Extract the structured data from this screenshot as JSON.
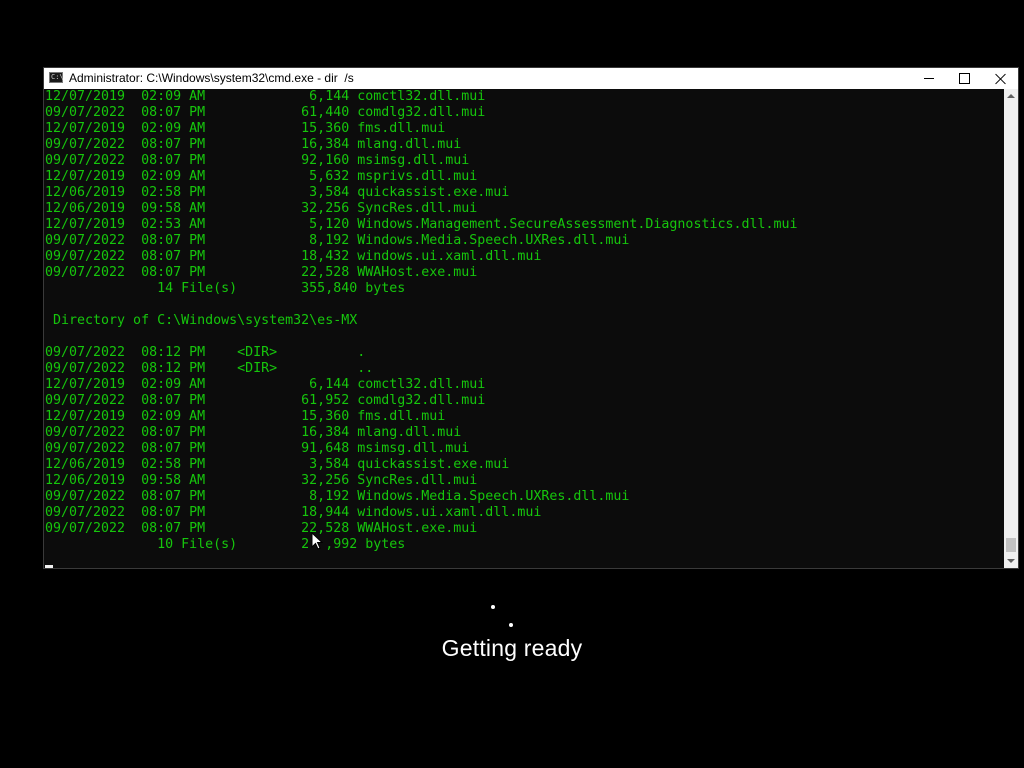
{
  "window": {
    "title": "Administrator: C:\\Windows\\system32\\cmd.exe - dir  /s",
    "icon": "cmd-icon",
    "icon_glyph": "C:\\",
    "buttons": {
      "minimize": "minimize-icon",
      "maximize": "maximize-icon",
      "close": "close-icon"
    }
  },
  "console": {
    "text_color": "#16c60c",
    "background": "#0c0c0c",
    "lines": [
      "12/07/2019  02:09 AM             6,144 comctl32.dll.mui",
      "09/07/2022  08:07 PM            61,440 comdlg32.dll.mui",
      "12/07/2019  02:09 AM            15,360 fms.dll.mui",
      "09/07/2022  08:07 PM            16,384 mlang.dll.mui",
      "09/07/2022  08:07 PM            92,160 msimsg.dll.mui",
      "12/07/2019  02:09 AM             5,632 msprivs.dll.mui",
      "12/06/2019  02:58 PM             3,584 quickassist.exe.mui",
      "12/06/2019  09:58 AM            32,256 SyncRes.dll.mui",
      "12/07/2019  02:53 AM             5,120 Windows.Management.SecureAssessment.Diagnostics.dll.mui",
      "09/07/2022  08:07 PM             8,192 Windows.Media.Speech.UXRes.dll.mui",
      "09/07/2022  08:07 PM            18,432 windows.ui.xaml.dll.mui",
      "09/07/2022  08:07 PM            22,528 WWAHost.exe.mui",
      "              14 File(s)        355,840 bytes",
      "",
      " Directory of C:\\Windows\\system32\\es-MX",
      "",
      "09/07/2022  08:12 PM    <DIR>          .",
      "09/07/2022  08:12 PM    <DIR>          ..",
      "12/07/2019  02:09 AM             6,144 comctl32.dll.mui",
      "09/07/2022  08:07 PM            61,952 comdlg32.dll.mui",
      "12/07/2019  02:09 AM            15,360 fms.dll.mui",
      "09/07/2022  08:07 PM            16,384 mlang.dll.mui",
      "09/07/2022  08:07 PM            91,648 msimsg.dll.mui",
      "12/06/2019  02:58 PM             3,584 quickassist.exe.mui",
      "12/06/2019  09:58 AM            32,256 SyncRes.dll.mui",
      "09/07/2022  08:07 PM             8,192 Windows.Media.Speech.UXRes.dll.mui",
      "09/07/2022  08:07 PM            18,944 windows.ui.xaml.dll.mui",
      "09/07/2022  08:07 PM            22,528 WWAHost.exe.mui",
      "              10 File(s)        2  ,992 bytes"
    ]
  },
  "scrollbar": {
    "up_arrow": "scroll-up-arrow-icon",
    "down_arrow": "scroll-down-arrow-icon",
    "position_fraction": 0.98
  },
  "overlay": {
    "status_text": "Getting ready",
    "spinner": "loading-spinner-icon"
  },
  "pointer": "mouse-pointer-icon"
}
